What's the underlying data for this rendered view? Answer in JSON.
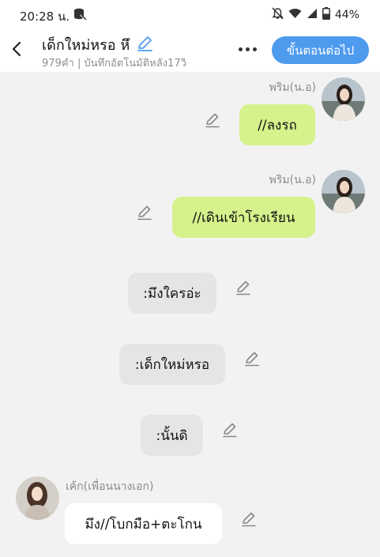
{
  "status_bar": {
    "time": "20:28 น.",
    "battery": "44%",
    "icons": [
      "data-saver-icon",
      "mute-bell-icon",
      "wifi-icon",
      "signal-icon",
      "battery-icon"
    ]
  },
  "header": {
    "title": "เด็กใหม่หรอ หึ",
    "subtitle": "979คำ | บันทึกอัตโนมัติหลัง17วิ",
    "next_button": "ขั้นตอนต่อไป",
    "accent": "#4e9bee"
  },
  "messages": [
    {
      "sender": "พริม(น.อ)",
      "text": "//ลงรถ",
      "side": "right",
      "style": "green"
    },
    {
      "sender": "พริม(น.อ)",
      "text": "//เดินเข้าโรงเรียน",
      "side": "right",
      "style": "green"
    },
    {
      "text": ":มึงใครอ่ะ",
      "side": "center",
      "style": "grey"
    },
    {
      "text": ":เด็กใหม่หรอ",
      "side": "center",
      "style": "grey"
    },
    {
      "text": ":นั้นดิ",
      "side": "center",
      "style": "grey"
    },
    {
      "sender": "เค้ก(เพื่อนนางเอก)",
      "text": "มึง//โบกมือ+ตะโกน",
      "side": "left",
      "style": "white"
    }
  ],
  "colors": {
    "bubble_green": "#d6f28c",
    "bubble_grey": "#e5e5e5",
    "chat_background": "#f2f2f2"
  }
}
